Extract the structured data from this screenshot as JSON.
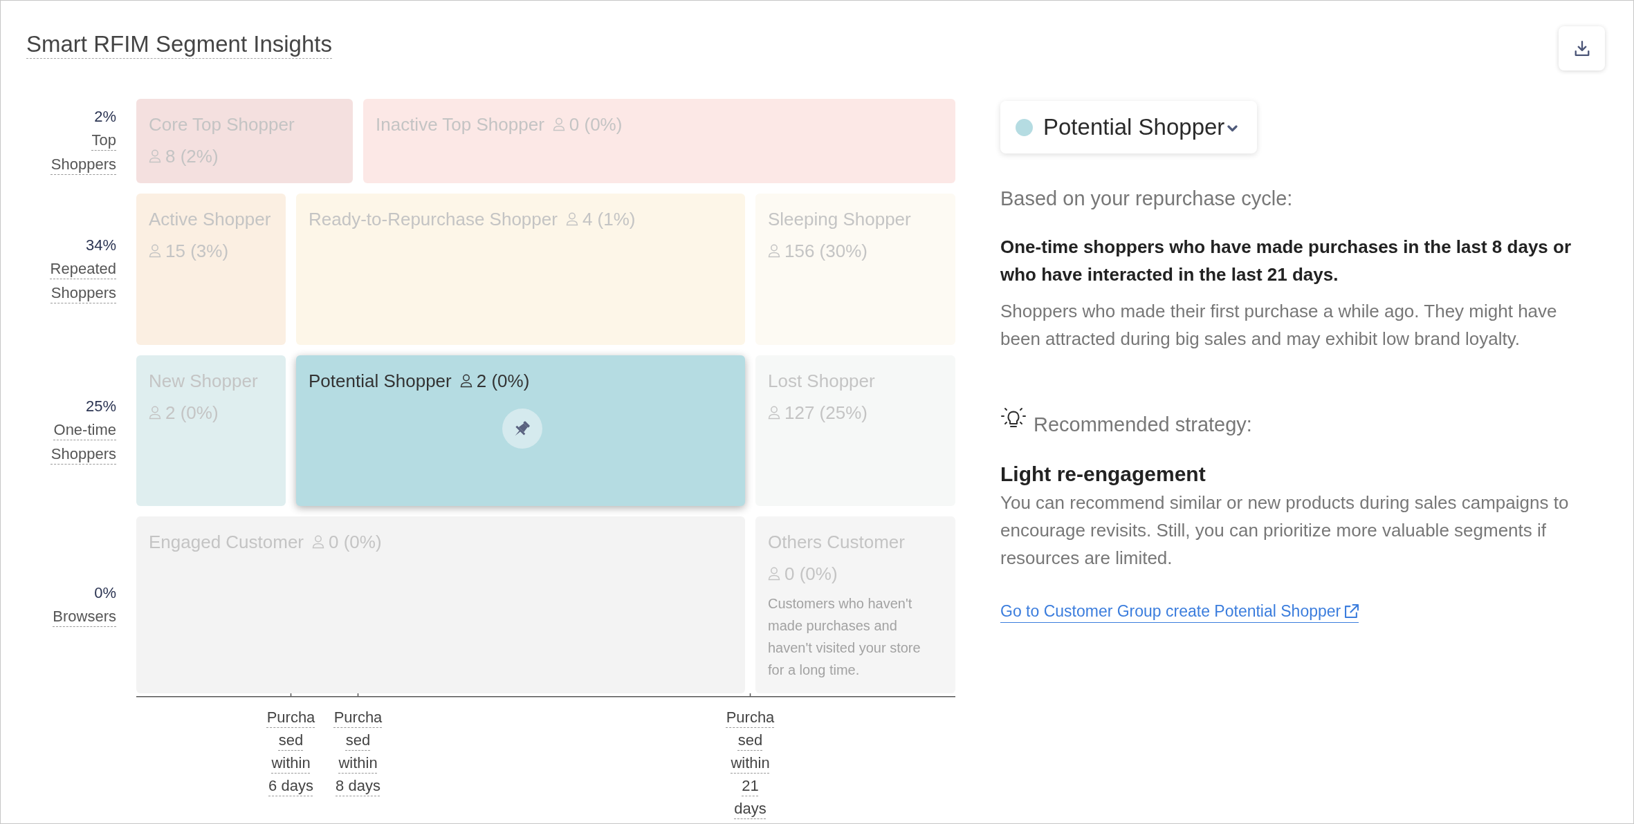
{
  "header": {
    "title": "Smart RFIM Segment Insights"
  },
  "matrix": {
    "rows": [
      {
        "percent": "2%",
        "label": "Top Shoppers",
        "segments": [
          {
            "name": "Core Top Shopper",
            "count": "8 (2%)",
            "color": "#f4e0df",
            "selected": false
          },
          {
            "name": "Inactive Top Shopper",
            "count": "0 (0%)",
            "color": "#fce8e6",
            "selected": false
          }
        ]
      },
      {
        "percent": "34%",
        "label": "Repeated Shoppers",
        "segments": [
          {
            "name": "Active Shopper",
            "count": "15 (3%)",
            "color": "#fbefe2",
            "selected": false
          },
          {
            "name": "Ready-to-Repurchase Shopper",
            "count": "4 (1%)",
            "color": "#fdf6e8",
            "selected": false
          },
          {
            "name": "Sleeping Shopper",
            "count": "156 (30%)",
            "color": "#fdfaf3",
            "selected": false
          }
        ]
      },
      {
        "percent": "25%",
        "label": "One-time Shoppers",
        "segments": [
          {
            "name": "New Shopper",
            "count": "2 (0%)",
            "color": "#dfeeef",
            "selected": false
          },
          {
            "name": "Potential Shopper",
            "count": "2 (0%)",
            "color": "#b5dce2",
            "selected": true
          },
          {
            "name": "Lost Shopper",
            "count": "127 (25%)",
            "color": "#f6f8f7",
            "selected": false
          }
        ]
      },
      {
        "percent": "0%",
        "label": "Browsers",
        "segments": [
          {
            "name": "Engaged Customer",
            "count": "0 (0%)",
            "color": "#f3f3f3",
            "selected": false
          },
          {
            "name": "Others Customer",
            "count": "0 (0%)",
            "color": "#f5f5f5",
            "selected": false,
            "description": "Customers who haven't made purchases and haven't visited your store for a long time."
          }
        ]
      }
    ],
    "x_axis": [
      "Purchased within 6 days",
      "Purchased within 8 days",
      "Purchased within 21 days"
    ]
  },
  "detail": {
    "selector": {
      "label": "Potential Shopper",
      "color": "#b5dce2"
    },
    "cycle_heading": "Based on your repurchase cycle:",
    "definition": "One-time shoppers who have made purchases in the last 8 days or who have interacted in the last 21 days.",
    "description": "Shoppers who made their first purchase a while ago. They might have been attracted during big sales and may exhibit low brand loyalty.",
    "strategy_heading": "Recommended strategy:",
    "strategy_title": "Light re-engagement",
    "strategy_text": "You can recommend similar or new products during sales campaigns to encourage revisits. Still, you can prioritize more valuable segments if resources are limited.",
    "link": "Go to Customer Group create Potential Shopper"
  }
}
